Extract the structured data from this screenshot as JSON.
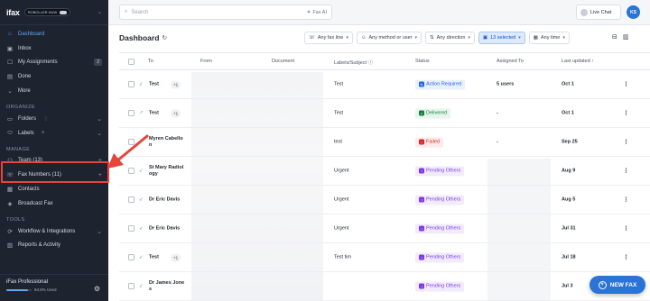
{
  "brand": {
    "logo": "ifax",
    "plan_pill": "ROBOLLER HUW"
  },
  "sidebar": {
    "nav": [
      {
        "label": "Dashboard",
        "icon": "home-icon",
        "active": true
      },
      {
        "label": "Inbox",
        "icon": "inbox-icon"
      },
      {
        "label": "My Assignments",
        "icon": "assignments-icon",
        "count": "2"
      },
      {
        "label": "Done",
        "icon": "done-icon"
      },
      {
        "label": "More",
        "icon": "chevron-down-icon"
      }
    ],
    "organize_heading": "ORGANIZE",
    "organize": [
      {
        "label": "Folders",
        "icon": "folder-icon"
      },
      {
        "label": "Labels",
        "icon": "label-icon"
      }
    ],
    "manage_heading": "MANAGE",
    "manage": [
      {
        "label": "Team (13)",
        "icon": "team-icon"
      },
      {
        "label": "Fax Numbers (11)",
        "icon": "fax-number-icon"
      },
      {
        "label": "Contacts",
        "icon": "contacts-icon"
      },
      {
        "label": "Broadcast Fax",
        "icon": "broadcast-icon"
      }
    ],
    "tools_heading": "TOOLS",
    "tools": [
      {
        "label": "Workflow & Integrations",
        "icon": "workflow-icon"
      },
      {
        "label": "Reports & Activity",
        "icon": "reports-icon"
      }
    ],
    "footer": {
      "plan": "iFax Professional",
      "usage": "84.8% Used",
      "usage_fraction": 0.848
    }
  },
  "topbar": {
    "search_placeholder": "Search",
    "fax_ai": "Fax AI",
    "live_chat": "Live Chat",
    "user_initials": "KS"
  },
  "dashboard": {
    "title": "Dashboard",
    "filters": [
      "Any fax line",
      "Any method or user",
      "Any direction",
      "13 selected",
      "Any time"
    ],
    "columns": {
      "to": "To",
      "from": "From",
      "document": "Document",
      "labels": "Labels/Subject",
      "status": "Status",
      "assigned": "Assigned To",
      "updated": "Last updated"
    },
    "rows": [
      {
        "to": "Test",
        "plus": "+1",
        "dir": "in",
        "label": "Test",
        "status": "Action Required",
        "status_type": "action",
        "assigned": "5 users",
        "updated": "Oct 1"
      },
      {
        "to": "Test",
        "plus": "+1",
        "dir": "out",
        "label": "Test",
        "status": "Delivered",
        "status_type": "delivered",
        "assigned": "-",
        "updated": "Oct 1"
      },
      {
        "to": "Myren Cabello\nn",
        "plus": "",
        "dir": "out",
        "label": "test",
        "status": "Failed",
        "status_type": "failed",
        "assigned": "-",
        "updated": "Sep 25"
      },
      {
        "to": "St Mary Radiol\nogy",
        "plus": "",
        "dir": "in",
        "label": "Urgent",
        "status": "Pending Others",
        "status_type": "pending",
        "assigned": "",
        "updated": "Aug 9"
      },
      {
        "to": "Dr Eric Davis",
        "plus": "",
        "dir": "in",
        "label": "Urgent",
        "status": "Pending Others",
        "status_type": "pending",
        "assigned": "",
        "updated": "Aug 5"
      },
      {
        "to": "Dr Eric Davis",
        "plus": "",
        "dir": "in",
        "label": "Urgent",
        "status": "Pending Others",
        "status_type": "pending",
        "assigned": "",
        "updated": "Jul 31"
      },
      {
        "to": "Test",
        "plus": "+1",
        "dir": "in",
        "label": "Test tim",
        "status": "Pending Others",
        "status_type": "pending",
        "assigned": "",
        "updated": "Jul 18"
      },
      {
        "to": "Dr James Jone\ns",
        "plus": "",
        "dir": "in",
        "label": "",
        "status": "Pending Others",
        "status_type": "pending",
        "assigned": "",
        "updated": "Jul 3"
      }
    ]
  },
  "new_fax_label": "NEW FAX",
  "colors": {
    "sidebar_bg": "#1e2330",
    "accent": "#2a74d6",
    "highlight": "#e5453b",
    "action": "#2563eb",
    "delivered": "#15803d",
    "failed": "#dc2626",
    "pending": "#7c3aed"
  }
}
